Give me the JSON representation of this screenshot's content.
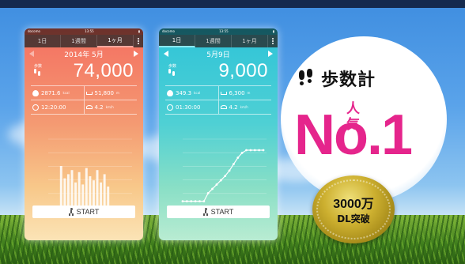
{
  "phone_left": {
    "status": {
      "carrier": "docomo",
      "time": "13:55",
      "battery": "▮"
    },
    "tabs": [
      {
        "label": "1日"
      },
      {
        "label": "1週間"
      },
      {
        "label": "1ヶ月"
      }
    ],
    "active_tab": 2,
    "date": "2014年 5月",
    "steps_label": "歩数",
    "steps": "74,000",
    "calories": "2871.6",
    "calories_unit": "kcal",
    "distance": "51,800",
    "distance_unit": "m",
    "time": "12:20:00",
    "speed": "4.2",
    "speed_unit": "km/h",
    "start_label": "START",
    "chart_data": {
      "type": "bar",
      "values": [
        1.0,
        0.7,
        0.8,
        0.9,
        0.6,
        0.85,
        0.55,
        0.95,
        0.75,
        0.65,
        0.9,
        0.6,
        0.8,
        0.5
      ]
    }
  },
  "phone_right": {
    "status": {
      "carrier": "docomo",
      "time": "13:55",
      "battery": "▮"
    },
    "tabs": [
      {
        "label": "1日"
      },
      {
        "label": "1週間"
      },
      {
        "label": "1ヶ月"
      }
    ],
    "active_tab": 0,
    "date": "5月9日",
    "steps_label": "歩数",
    "steps": "9,000",
    "calories": "349.3",
    "calories_unit": "kcal",
    "distance": "6,300",
    "distance_unit": "m",
    "time": "01:30:00",
    "speed": "4.2",
    "speed_unit": "km/h",
    "start_label": "START",
    "chart_data": {
      "type": "line",
      "values": [
        0.05,
        0.05,
        0.05,
        0.05,
        0.05,
        0.05,
        0.2,
        0.28,
        0.36,
        0.44,
        0.52,
        0.62,
        0.74,
        0.86,
        0.95,
        1.0,
        1.0,
        1.0,
        1.0,
        1.0
      ]
    }
  },
  "badge": {
    "brand": "歩数計",
    "ninki": "人気",
    "no1": "No.1",
    "seal_line1": "3000万",
    "seal_line2": "DL突破"
  },
  "colors": {
    "accent_pink": "#e5258c",
    "gold": "#cdb030",
    "coral": "#f46f61",
    "teal": "#2fc4d8"
  }
}
